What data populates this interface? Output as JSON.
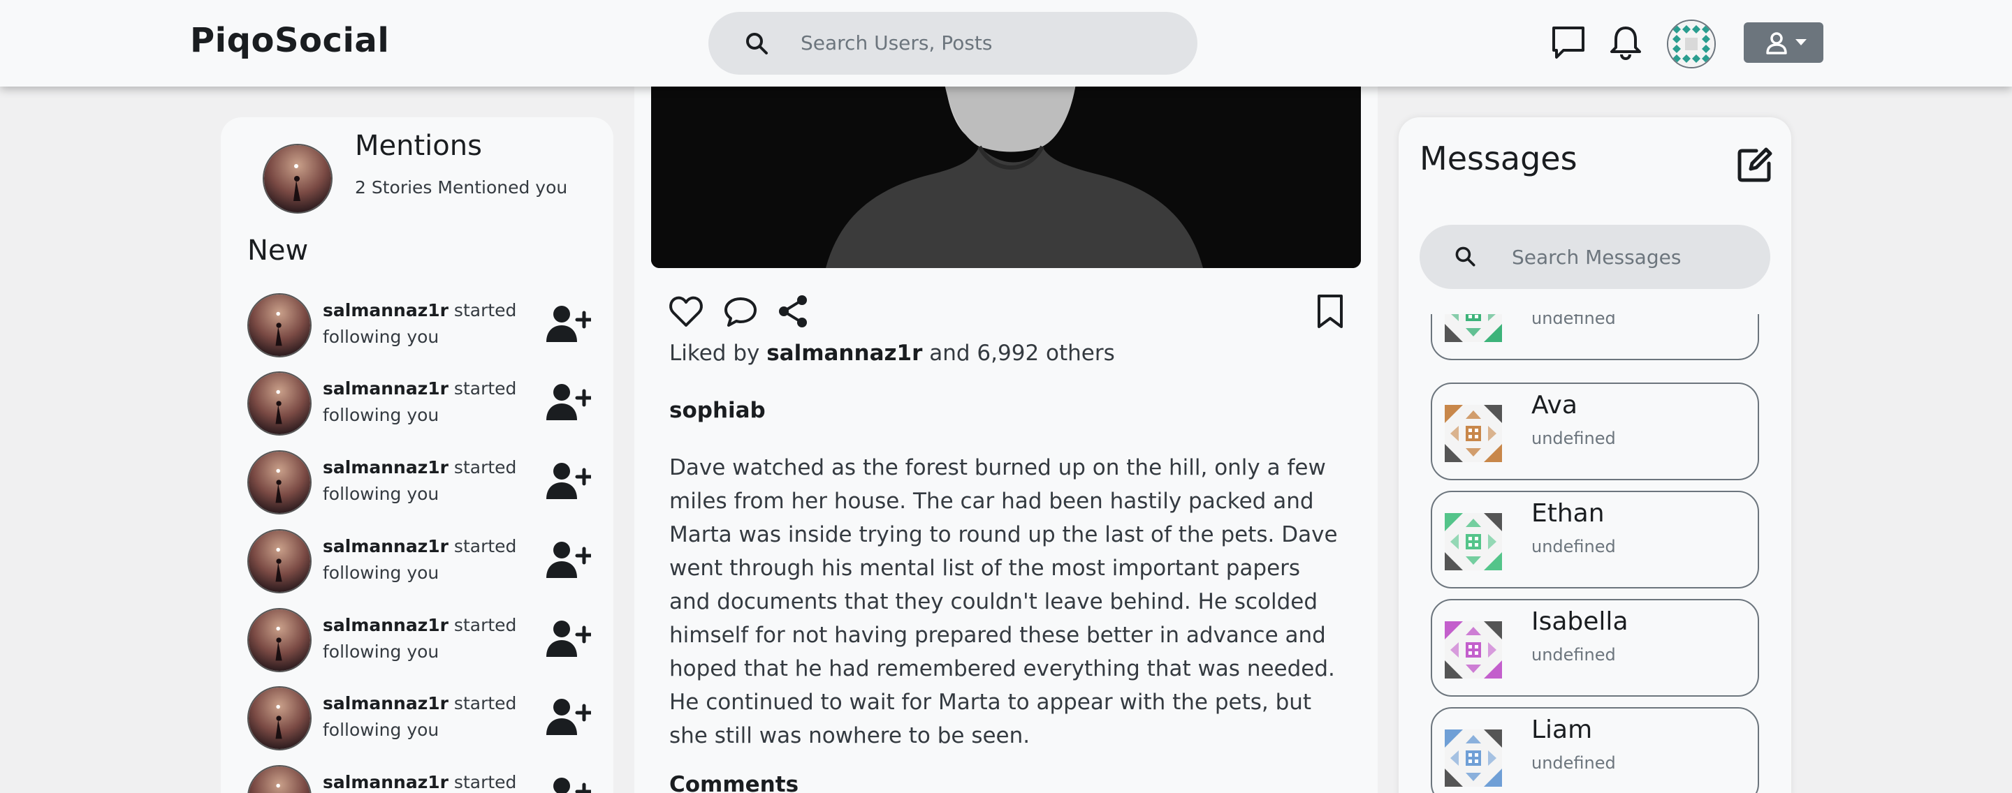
{
  "nav": {
    "brand": "PiqoSocial",
    "search_placeholder": "Search Users, Posts"
  },
  "left": {
    "mentions_title": "Mentions",
    "mentions_subtitle": "2 Stories Mentioned you",
    "new_title": "New",
    "notifications": [
      {
        "user": "salmannaz1r",
        "text": " started following you"
      },
      {
        "user": "salmannaz1r",
        "text": " started following you"
      },
      {
        "user": "salmannaz1r",
        "text": " started following you"
      },
      {
        "user": "salmannaz1r",
        "text": " started following you"
      },
      {
        "user": "salmannaz1r",
        "text": " started following you"
      },
      {
        "user": "salmannaz1r",
        "text": " started following you"
      },
      {
        "user": "salmannaz1r",
        "text": " started"
      }
    ]
  },
  "post": {
    "liked_prefix": "Liked by ",
    "liked_user": "salmannaz1r",
    "liked_suffix": " and 6,992 others",
    "author": "sophiab",
    "text": "Dave watched as the forest burned up on the hill, only a few miles from her house. The car had been hastily packed and Marta was inside trying to round up the last of the pets. Dave went through his mental list of the most important papers and documents that they couldn't leave behind. He scolded himself for not having prepared these better in advance and hoped that he had remembered everything that was needed. He continued to wait for Marta to appear with the pets, but she still was nowhere to be seen.",
    "comments_title": "Comments"
  },
  "messages": {
    "title": "Messages",
    "search_placeholder": "Search Messages",
    "items": [
      {
        "name": "",
        "sub": "undefined",
        "color": "#3db37a"
      },
      {
        "name": "Ava",
        "sub": "undefined",
        "color": "#c8874a"
      },
      {
        "name": "Ethan",
        "sub": "undefined",
        "color": "#54c48a"
      },
      {
        "name": "Isabella",
        "sub": "undefined",
        "color": "#c35fcc"
      },
      {
        "name": "Liam",
        "sub": "undefined",
        "color": "#6f9fd6"
      }
    ]
  },
  "colors": {
    "navbar": "#f8f9fa",
    "page": "#f0f0f1",
    "search": "#e1e3e6",
    "user_button": "#6c757d"
  }
}
